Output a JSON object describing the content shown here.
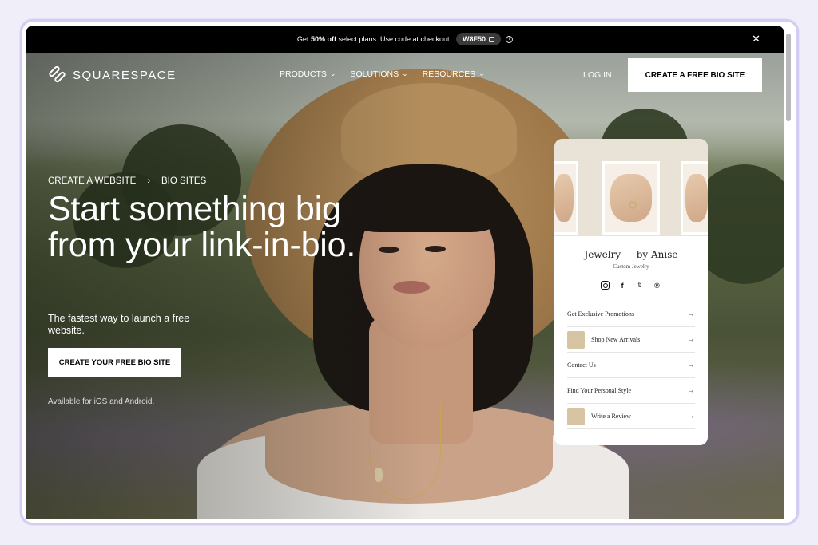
{
  "announcement": {
    "text_before": "Get ",
    "discount": "50% off",
    "text_after": " select plans. Use code at checkout:",
    "code": "W8F50"
  },
  "nav": {
    "logo_text": "SQUARESPACE",
    "menu": [
      {
        "label": "PRODUCTS"
      },
      {
        "label": "SOLUTIONS"
      },
      {
        "label": "RESOURCES"
      }
    ],
    "login": "LOG IN",
    "cta": "CREATE A FREE BIO SITE"
  },
  "hero": {
    "breadcrumb": [
      "CREATE A WEBSITE",
      "BIO SITES"
    ],
    "headline": "Start something big from your link-in-bio.",
    "subline": "The fastest way to launch a free website.",
    "cta": "CREATE YOUR FREE BIO SITE",
    "availability": "Available for iOS and Android."
  },
  "bio_card": {
    "title": "Jewelry — by Anise",
    "subtitle": "Custom Jewelry",
    "links": [
      {
        "label": "Get Exclusive Promotions"
      },
      {
        "label": "Shop New Arrivals"
      },
      {
        "label": "Contact Us"
      },
      {
        "label": "Find Your Personal Style"
      },
      {
        "label": "Write a Review"
      }
    ]
  },
  "colors": {
    "accent": "#000000",
    "frame": "#d4ccf4",
    "background": "#f0eef8"
  }
}
